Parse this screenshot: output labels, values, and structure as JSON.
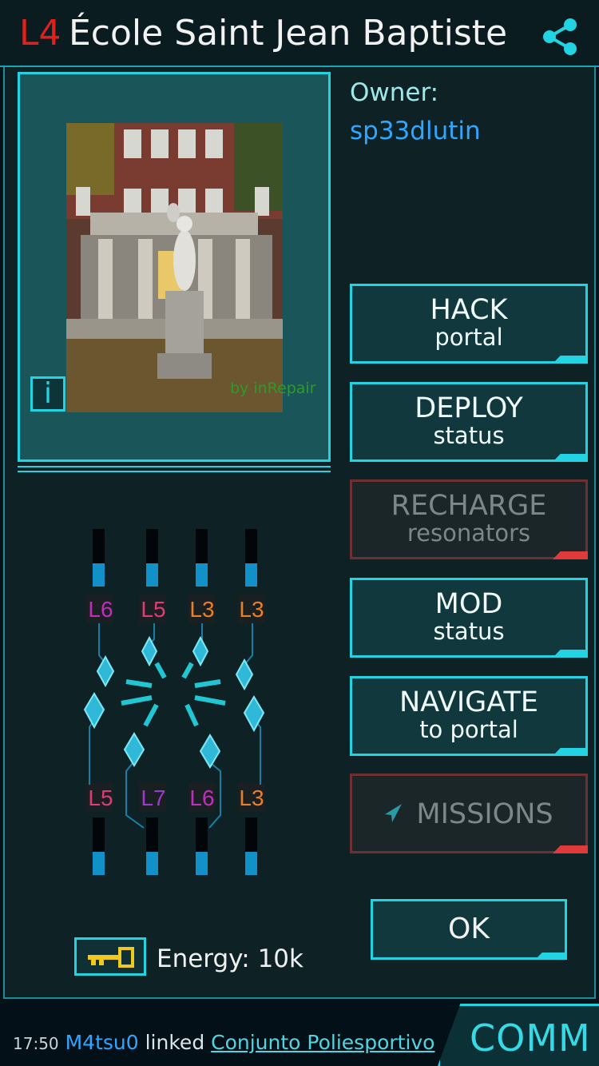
{
  "header": {
    "level": "L4",
    "portal_name": "École Saint Jean Baptiste"
  },
  "icons": {
    "share": "share-icon",
    "info": "info-icon",
    "key": "key-icon",
    "missions": "missions-arrow-icon"
  },
  "photo": {
    "credit": "by inRepair",
    "info_label": "i"
  },
  "owner": {
    "label": "Owner:",
    "name": "sp33dlutin"
  },
  "actions": {
    "hack": {
      "line1": "HACK",
      "line2": "portal"
    },
    "deploy": {
      "line1": "DEPLOY",
      "line2": "status"
    },
    "recharge": {
      "line1": "RECHARGE",
      "line2": "resonators"
    },
    "mod": {
      "line1": "MOD",
      "line2": "status"
    },
    "navigate": {
      "line1": "NAVIGATE",
      "line2": "to portal"
    },
    "missions": {
      "label": "MISSIONS"
    },
    "ok": "OK"
  },
  "resonators": {
    "top": [
      "L6",
      "L5",
      "L3",
      "L3"
    ],
    "bottom": [
      "L5",
      "L7",
      "L6",
      "L3"
    ]
  },
  "energy": "Energy: 10k",
  "comm": {
    "time": "17:50",
    "user": "M4tsu0",
    "action": "linked",
    "place": "Conjunto Poliesportivo",
    "tab": "COMM"
  },
  "colors": {
    "accent": "#22d4e2",
    "enemy_level": "#e0201c",
    "owner": "#2fa6ff",
    "disabled_border": "#6e2f32"
  }
}
